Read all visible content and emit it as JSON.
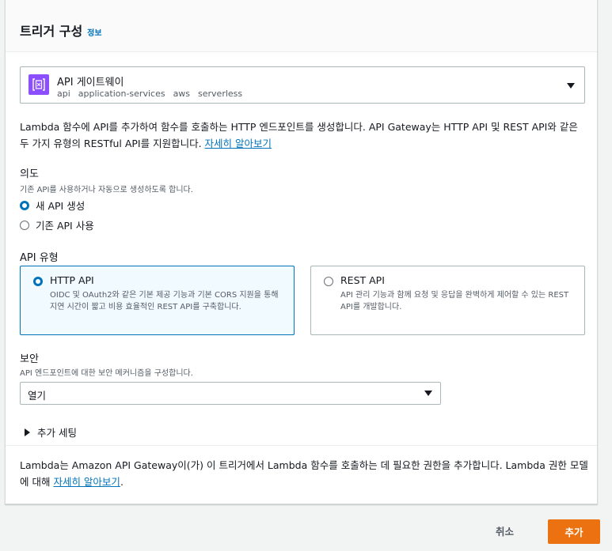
{
  "header": {
    "title": "트리거 구성",
    "info_link": "정보"
  },
  "trigger_select": {
    "icon": "api-gateway-icon",
    "title": "API 게이트웨이",
    "tags": [
      "api",
      "application-services",
      "aws",
      "serverless"
    ]
  },
  "description": {
    "text": "Lambda 함수에 API를 추가하여 함수를 호출하는 HTTP 엔드포인트를 생성합니다. API Gateway는 HTTP API 및 REST API와 같은 두 가지 유형의 RESTful API를 지원합니다. ",
    "link": "자세히 알아보기"
  },
  "intent": {
    "label": "의도",
    "sublabel": "기존 API를 사용하거나 자동으로 생성하도록 합니다.",
    "options": [
      {
        "label": "새 API 생성",
        "selected": true
      },
      {
        "label": "기존 API 사용",
        "selected": false
      }
    ]
  },
  "api_type": {
    "label": "API 유형",
    "options": [
      {
        "title": "HTTP API",
        "desc": "OIDC 및 OAuth2와 같은 기본 제공 기능과 기본 CORS 지원을 통해 지연 시간이 짧고 비용 효율적인 REST API를 구축합니다.",
        "selected": true
      },
      {
        "title": "REST API",
        "desc": "API 관리 기능과 함께 요청 및 응답을 완벽하게 제어할 수 있는 REST API를 개발합니다.",
        "selected": false
      }
    ]
  },
  "security": {
    "label": "보안",
    "sublabel": "API 엔드포인트에 대한 보안 메커니즘을 구성합니다.",
    "value": "열기"
  },
  "additional": {
    "label": "추가 세팅"
  },
  "footnote": {
    "text": "Lambda는 Amazon API Gateway이(가) 이 트리거에서 Lambda 함수를 호출하는 데 필요한 권한을 추가합니다. Lambda 권한 모델에 대해 ",
    "link": "자세히 알아보기",
    "suffix": "."
  },
  "actions": {
    "cancel": "취소",
    "add": "추가"
  },
  "colors": {
    "primary_button": "#ec7211",
    "link": "#0073bb",
    "selected_tile_bg": "#f1faff",
    "api_icon_bg": "#8c4fff"
  }
}
